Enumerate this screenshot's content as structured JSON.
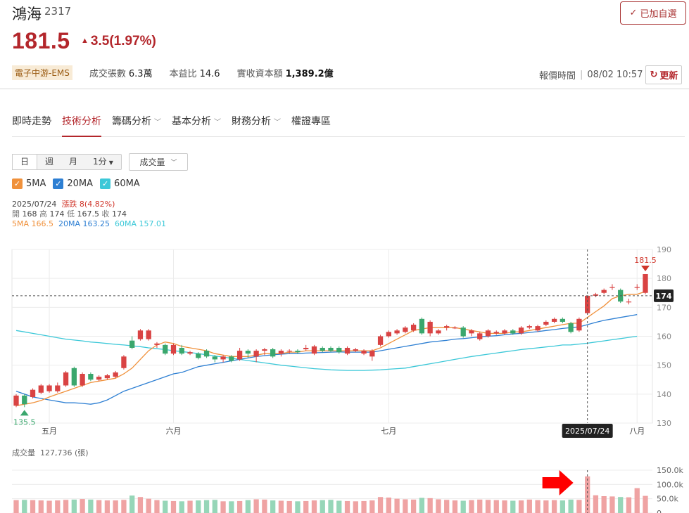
{
  "stock": {
    "name": "鴻海",
    "code": "2317",
    "price": "181.5",
    "change": "3.5",
    "change_pct": "(1.97%)",
    "watch_label": "已加自選",
    "industry_tag": "電子中游-EMS",
    "volume_label": "成交張數",
    "volume_value": "6.3萬",
    "pe_label": "本益比",
    "pe_value": "14.6",
    "capital_label": "實收資本額",
    "capital_value": "1,389.2億",
    "time_label": "報價時間",
    "time_value": "08/02 10:57",
    "refresh_label": "更新"
  },
  "tabs": [
    {
      "label": "即時走勢",
      "dropdown": false
    },
    {
      "label": "技術分析",
      "dropdown": false,
      "active": true
    },
    {
      "label": "籌碼分析",
      "dropdown": true
    },
    {
      "label": "基本分析",
      "dropdown": true
    },
    {
      "label": "財務分析",
      "dropdown": true
    },
    {
      "label": "權證專區",
      "dropdown": false
    }
  ],
  "periods": [
    "日",
    "週",
    "月",
    "1分"
  ],
  "indicator_select": "成交量",
  "ma_toggles": [
    {
      "label": "5MA",
      "color": "#f0913b"
    },
    {
      "label": "20MA",
      "color": "#2d7fd3"
    },
    {
      "label": "60MA",
      "color": "#3cc8d8"
    }
  ],
  "ohlc": {
    "date": "2025/07/24",
    "limit_text": "漲跌 8(4.82%)",
    "open_label": "開",
    "open": "168",
    "high_label": "高",
    "high": "174",
    "low_label": "低",
    "low": "167.5",
    "close_label": "收",
    "close": "174",
    "ma5": "5MA 166.5",
    "ma20": "20MA 163.25",
    "ma60": "60MA 157.01"
  },
  "volume_header": {
    "label": "成交量",
    "value": "127,736",
    "unit": "(張)"
  },
  "chart_data": {
    "type": "candlestick",
    "y_ticks": [
      "190",
      "180",
      "170",
      "160",
      "150",
      "140",
      "130"
    ],
    "ylim": [
      130,
      190
    ],
    "x_labels": [
      "五月",
      "六月",
      "七月",
      "八月"
    ],
    "hover_date": "2025/07/24",
    "hover_price": "174",
    "high_marker": "181.5",
    "low_marker": "135.5",
    "up_color": "#d94343",
    "down_color": "#3aa76d",
    "candles": [
      {
        "o": 136,
        "c": 139.5,
        "h": 140,
        "l": 135.5
      },
      {
        "o": 139.5,
        "c": 136.5,
        "h": 140,
        "l": 135.5
      },
      {
        "o": 139,
        "c": 141.5,
        "h": 142,
        "l": 138.5
      },
      {
        "o": 140.5,
        "c": 143,
        "h": 143.5,
        "l": 140
      },
      {
        "o": 141,
        "c": 143,
        "h": 143.5,
        "l": 140.5
      },
      {
        "o": 141,
        "c": 143,
        "h": 144,
        "l": 140.5
      },
      {
        "o": 143,
        "c": 147.5,
        "h": 148,
        "l": 142.5
      },
      {
        "o": 149,
        "c": 143,
        "h": 149.5,
        "l": 142.5
      },
      {
        "o": 143,
        "c": 147,
        "h": 147.5,
        "l": 142.5
      },
      {
        "o": 147,
        "c": 145,
        "h": 147.5,
        "l": 144.5
      },
      {
        "o": 145,
        "c": 146,
        "h": 146.5,
        "l": 144.5
      },
      {
        "o": 145.5,
        "c": 146.5,
        "h": 147,
        "l": 145
      },
      {
        "o": 146,
        "c": 147.5,
        "h": 148,
        "l": 145.5
      },
      {
        "o": 149,
        "c": 153,
        "h": 153.5,
        "l": 148.5
      },
      {
        "o": 158.5,
        "c": 156,
        "h": 160,
        "l": 155.5
      },
      {
        "o": 159,
        "c": 162,
        "h": 162.5,
        "l": 158.5
      },
      {
        "o": 159,
        "c": 162,
        "h": 162.5,
        "l": 158.5
      },
      {
        "o": 157,
        "c": 157.5,
        "h": 158,
        "l": 156
      },
      {
        "o": 157,
        "c": 154,
        "h": 157.5,
        "l": 153.5
      },
      {
        "o": 154,
        "c": 157,
        "h": 157.5,
        "l": 153.5
      },
      {
        "o": 156,
        "c": 154,
        "h": 157,
        "l": 153.5
      },
      {
        "o": 154,
        "c": 154.5,
        "h": 155,
        "l": 153.5
      },
      {
        "o": 154,
        "c": 152.5,
        "h": 154.5,
        "l": 152
      },
      {
        "o": 155,
        "c": 153,
        "h": 155.5,
        "l": 152.5
      },
      {
        "o": 153,
        "c": 152,
        "h": 153.5,
        "l": 151
      },
      {
        "o": 152,
        "c": 153,
        "h": 153.5,
        "l": 151
      },
      {
        "o": 153,
        "c": 151.5,
        "h": 153.5,
        "l": 151
      },
      {
        "o": 152,
        "c": 155,
        "h": 156,
        "l": 151.5
      },
      {
        "o": 155,
        "c": 154,
        "h": 155.5,
        "l": 152.5
      },
      {
        "o": 153,
        "c": 155,
        "h": 155.5,
        "l": 151
      },
      {
        "o": 155,
        "c": 155.5,
        "h": 156,
        "l": 153.5
      },
      {
        "o": 155.5,
        "c": 153,
        "h": 156,
        "l": 152.5
      },
      {
        "o": 154,
        "c": 155,
        "h": 155.5,
        "l": 153
      },
      {
        "o": 155,
        "c": 155,
        "h": 155.5,
        "l": 154
      },
      {
        "o": 155,
        "c": 154.5,
        "h": 155.5,
        "l": 154
      },
      {
        "o": 155.5,
        "c": 156,
        "h": 157,
        "l": 155
      },
      {
        "o": 154,
        "c": 156.5,
        "h": 157,
        "l": 153.5
      },
      {
        "o": 156,
        "c": 155,
        "h": 156.5,
        "l": 154.5
      },
      {
        "o": 156,
        "c": 155,
        "h": 156.5,
        "l": 154.5
      },
      {
        "o": 156,
        "c": 154.5,
        "h": 156.5,
        "l": 154
      },
      {
        "o": 154,
        "c": 156,
        "h": 156.5,
        "l": 153.5
      },
      {
        "o": 155,
        "c": 155.5,
        "h": 156,
        "l": 154.5
      },
      {
        "o": 154,
        "c": 155,
        "h": 155.5,
        "l": 153.5
      },
      {
        "o": 153,
        "c": 155,
        "h": 155.5,
        "l": 151.5
      },
      {
        "o": 157,
        "c": 160,
        "h": 160.5,
        "l": 156.5
      },
      {
        "o": 160,
        "c": 161.5,
        "h": 162,
        "l": 159.5
      },
      {
        "o": 161,
        "c": 162,
        "h": 162.5,
        "l": 160.5
      },
      {
        "o": 161.5,
        "c": 163,
        "h": 163.5,
        "l": 161
      },
      {
        "o": 162,
        "c": 164,
        "h": 164.5,
        "l": 161.5
      },
      {
        "o": 166,
        "c": 161,
        "h": 166.5,
        "l": 160.5
      },
      {
        "o": 161,
        "c": 165,
        "h": 165.5,
        "l": 160
      },
      {
        "o": 161,
        "c": 162,
        "h": 162.5,
        "l": 160.5
      },
      {
        "o": 163,
        "c": 163.5,
        "h": 164,
        "l": 162
      },
      {
        "o": 163,
        "c": 163,
        "h": 163.5,
        "l": 162.5
      },
      {
        "o": 163,
        "c": 160,
        "h": 163.5,
        "l": 159.5
      },
      {
        "o": 161,
        "c": 162,
        "h": 162.5,
        "l": 160
      },
      {
        "o": 159,
        "c": 161,
        "h": 161.5,
        "l": 158.5
      },
      {
        "o": 160,
        "c": 162,
        "h": 162.5,
        "l": 159.5
      },
      {
        "o": 161,
        "c": 161.5,
        "h": 162,
        "l": 160.5
      },
      {
        "o": 161,
        "c": 162,
        "h": 162.5,
        "l": 160.5
      },
      {
        "o": 162,
        "c": 161,
        "h": 162.5,
        "l": 160.5
      },
      {
        "o": 161,
        "c": 163,
        "h": 163.5,
        "l": 160.5
      },
      {
        "o": 163,
        "c": 163.5,
        "h": 164,
        "l": 162.5
      },
      {
        "o": 162,
        "c": 163.5,
        "h": 164,
        "l": 161.5
      },
      {
        "o": 164,
        "c": 165,
        "h": 165.5,
        "l": 163.5
      },
      {
        "o": 165,
        "c": 166,
        "h": 166.5,
        "l": 164.5
      },
      {
        "o": 166,
        "c": 165,
        "h": 166.5,
        "l": 164.5
      },
      {
        "o": 164.5,
        "c": 161.5,
        "h": 165,
        "l": 161
      },
      {
        "o": 162,
        "c": 166,
        "h": 166.5,
        "l": 161.5
      },
      {
        "o": 168,
        "c": 174,
        "h": 174,
        "l": 167.5
      },
      {
        "o": 174,
        "c": 174.5,
        "h": 175,
        "l": 173.5
      },
      {
        "o": 175,
        "c": 176,
        "h": 176.5,
        "l": 174.5
      },
      {
        "o": 177,
        "c": 177,
        "h": 178,
        "l": 176
      },
      {
        "o": 176,
        "c": 172,
        "h": 176.5,
        "l": 171.5
      },
      {
        "o": 172,
        "c": 172,
        "h": 173,
        "l": 171
      },
      {
        "o": 177,
        "c": 177,
        "h": 178,
        "l": 176
      },
      {
        "o": 175,
        "c": 181.5,
        "h": 181.5,
        "l": 174.5
      }
    ],
    "ma5": [
      136,
      136.5,
      137,
      137.8,
      139,
      140,
      141,
      142,
      143,
      144,
      144.5,
      145,
      145.5,
      147,
      149,
      152,
      155,
      157,
      158,
      157.5,
      156.5,
      156,
      155.5,
      155,
      154,
      153.5,
      153,
      153,
      153,
      153.5,
      154,
      154,
      154,
      154.5,
      154.5,
      155,
      155,
      155,
      155,
      155,
      155,
      155,
      155,
      155,
      156,
      157.5,
      159,
      160.5,
      162,
      162.5,
      163,
      163,
      163,
      163,
      162.5,
      162,
      161.5,
      161,
      161,
      161,
      161.5,
      161.5,
      162,
      162.5,
      163,
      163.5,
      164,
      164.5,
      164.5,
      166.5,
      168.5,
      170.5,
      173,
      174,
      174.5,
      174.5,
      175.5
    ],
    "ma20": [
      141,
      140,
      139,
      138.5,
      138,
      137.5,
      137,
      137,
      136.8,
      136.5,
      137,
      138,
      139.5,
      141,
      142,
      143,
      144,
      145,
      146,
      147,
      147.5,
      148.5,
      149.5,
      150,
      150.5,
      151,
      151.5,
      152,
      152.5,
      153,
      153.3,
      153.6,
      153.8,
      154,
      154,
      154.2,
      154.3,
      154.4,
      154.5,
      154.6,
      154.5,
      154.5,
      154.5,
      154.5,
      155,
      155.5,
      156,
      156.5,
      157,
      157.5,
      158,
      158.3,
      158.6,
      159,
      159.2,
      159.5,
      159.8,
      160,
      160.2,
      160.5,
      160.8,
      161,
      161.3,
      161.6,
      162,
      162.3,
      162.7,
      163,
      163.25,
      164,
      164.8,
      165.5,
      166,
      166.5,
      167,
      167.5
    ],
    "ma60": [
      162,
      161.5,
      161,
      160.5,
      160,
      159.5,
      159,
      158.7,
      158.4,
      158,
      157.8,
      157.5,
      157.2,
      157,
      156.7,
      156.4,
      156,
      155.7,
      155.4,
      155,
      154.7,
      154.4,
      154,
      153.6,
      153.2,
      152.8,
      152.4,
      152,
      151.6,
      151.2,
      150.8,
      150.4,
      150,
      149.7,
      149.4,
      149.1,
      148.8,
      148.6,
      148.4,
      148.3,
      148.2,
      148.2,
      148.2,
      148.3,
      148.4,
      148.6,
      148.8,
      149,
      149.5,
      150,
      150.5,
      151,
      151.5,
      152,
      152.5,
      153,
      153.4,
      153.8,
      154.2,
      154.6,
      155,
      155.4,
      155.7,
      156,
      156.3,
      156.6,
      157,
      157.01,
      157.3,
      157.6,
      158,
      158.4,
      158.8,
      159.2,
      159.6,
      160
    ],
    "volume_ticks": [
      "150.0k",
      "100.0k",
      "50.0k",
      "0"
    ],
    "volumes": [
      45,
      46,
      45,
      44,
      43,
      44,
      46,
      47,
      49,
      47,
      45,
      44,
      44,
      46,
      61,
      56,
      50,
      45,
      43,
      42,
      41,
      43,
      44,
      45,
      46,
      41,
      41,
      42,
      45,
      48,
      47,
      44,
      43,
      42,
      41,
      42,
      44,
      45,
      46,
      43,
      42,
      41,
      42,
      44,
      56,
      54,
      50,
      48,
      47,
      53,
      52,
      48,
      46,
      44,
      43,
      45,
      47,
      46,
      45,
      44,
      43,
      44,
      47,
      45,
      44,
      45,
      44,
      47,
      46,
      128,
      62,
      59,
      58,
      56,
      55,
      87,
      60
    ]
  }
}
